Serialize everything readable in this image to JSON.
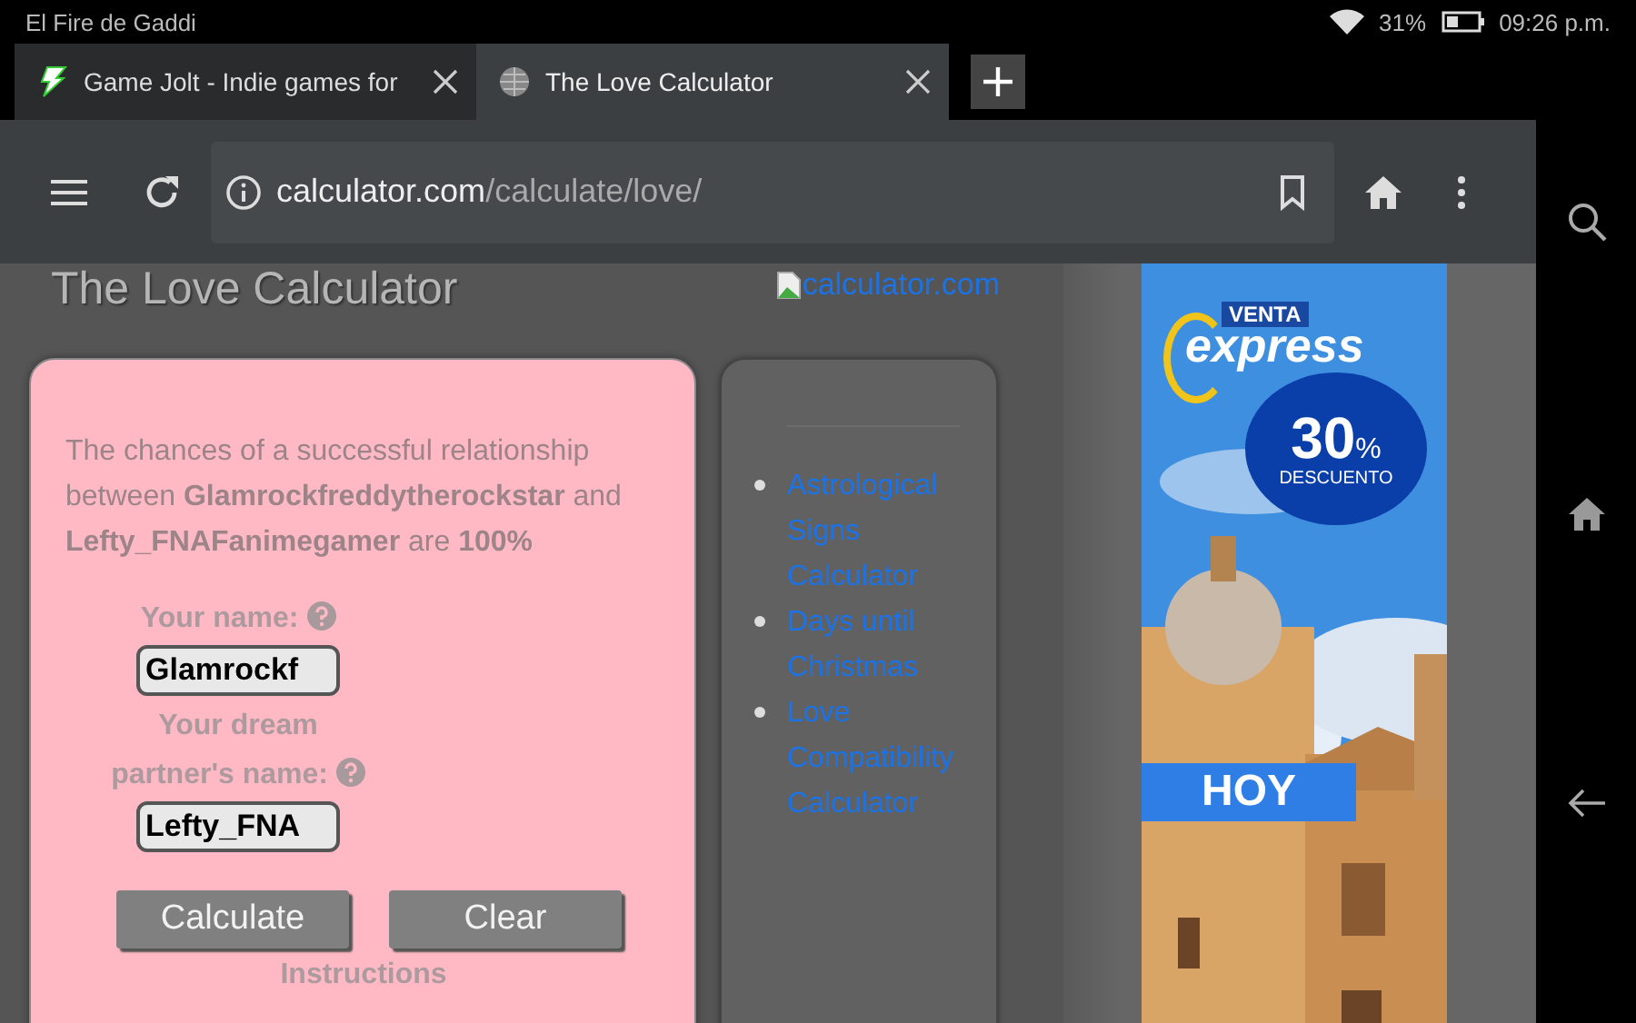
{
  "status_bar": {
    "device_name": "El Fire de Gaddi",
    "battery": "31%",
    "time": "09:26 p.m."
  },
  "tabs": [
    {
      "title": "Game Jolt - Indie games for",
      "selected": false
    },
    {
      "title": "The Love Calculator",
      "selected": true
    }
  ],
  "address_bar": {
    "domain": "calculator.com",
    "path": "/calculate/love/"
  },
  "page": {
    "title": "The Love Calculator",
    "logo_alt": "calculator.com",
    "result": "The chances of a successful relationship between **Glamrockfreddytherockstar** and **Lefty_FNAFanimegamer** are **100%**",
    "fields": [
      {
        "label": "Your name:",
        "value": "Glamrockf"
      },
      {
        "label": "Your dream partner's name:",
        "value": "Lefty_FNA"
      }
    ],
    "buttons": [
      "Calculate",
      "Clear"
    ],
    "instructions": "Instructions",
    "links": [
      "Astrological Signs Calculator",
      "Days until Christmas",
      "Love Compatibility Calculator"
    ]
  },
  "ad": {
    "kind": "picture",
    "brand_top": "VENTA",
    "brand": "express",
    "discount": "30",
    "percent": "%",
    "discount_label": "DESCUENTO",
    "cta": "HOY"
  }
}
